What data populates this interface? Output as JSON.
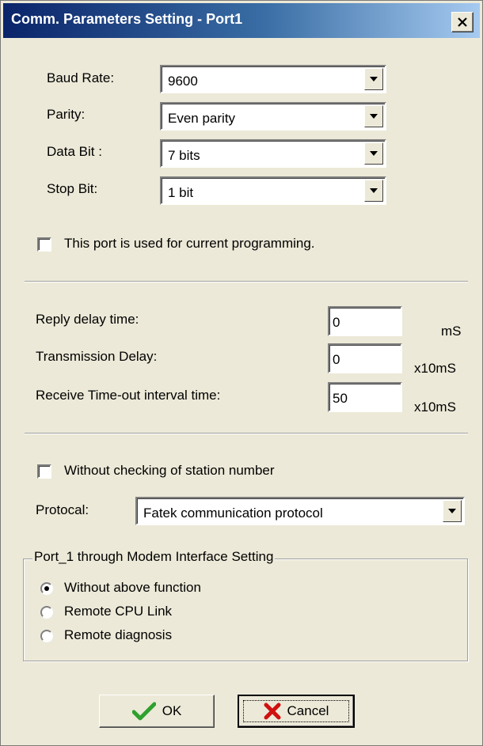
{
  "window": {
    "title": "Comm. Parameters Setting - Port1",
    "close_label": "X"
  },
  "fields": [
    {
      "label": "Baud Rate:",
      "value": "9600"
    },
    {
      "label": "Parity:",
      "value": "Even parity"
    },
    {
      "label": "Data Bit :",
      "value": "7 bits"
    },
    {
      "label": "Stop Bit:",
      "value": "1 bit"
    }
  ],
  "current_programming": {
    "label": "This port is used for current programming.",
    "checked": false
  },
  "timing": [
    {
      "label": "Reply delay time:",
      "value": "0",
      "unit": "mS"
    },
    {
      "label": "Transmission Delay:",
      "value": "0",
      "unit": "x10mS"
    },
    {
      "label": "Receive Time-out interval time:",
      "value": "50",
      "unit": "x10mS"
    }
  ],
  "station_check": {
    "label": "Without checking of station number",
    "checked": false
  },
  "protocol": {
    "label": "Protocal:",
    "value": "Fatek communication protocol"
  },
  "modem_group": {
    "title": "Port_1 through Modem Interface Setting",
    "options": [
      {
        "label": "Without above function",
        "selected": true
      },
      {
        "label": "Remote CPU Link",
        "selected": false
      },
      {
        "label": "Remote diagnosis",
        "selected": false
      }
    ]
  },
  "buttons": {
    "ok": "OK",
    "cancel": "Cancel"
  },
  "colors": {
    "titlebar_start": "#0a246a",
    "titlebar_end": "#a6caf0",
    "ok_check": "#2ea02e",
    "cancel_x": "#d01010"
  },
  "icons": {
    "ok": "checkmark-icon",
    "cancel": "x-icon",
    "dropdown": "chevron-down-icon"
  }
}
